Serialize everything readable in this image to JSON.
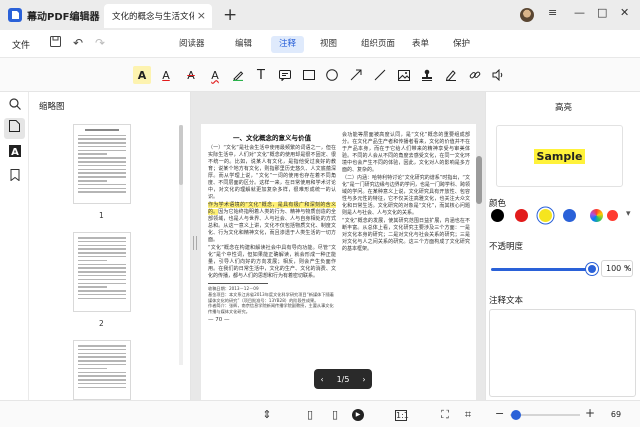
{
  "app": {
    "title": "幕动PDF编辑器"
  },
  "tabs": [
    {
      "label": "文化的概念与生活文化..."
    }
  ],
  "menu": {
    "file": "文件",
    "items": [
      {
        "label": "阅读器",
        "active": false
      },
      {
        "label": "编辑",
        "active": false
      },
      {
        "label": "注释",
        "active": true
      },
      {
        "label": "视图",
        "active": false
      },
      {
        "label": "组织页面",
        "active": false
      },
      {
        "label": "表单",
        "active": false
      },
      {
        "label": "保护",
        "active": false
      }
    ]
  },
  "toolbar": {
    "tools": [
      "highlight-icon",
      "underline-icon",
      "strikethrough-icon",
      "squiggly-icon",
      "pencil-icon",
      "text-icon",
      "note-icon",
      "rectangle-icon",
      "circle-icon",
      "arrow-icon",
      "line-icon",
      "image-icon",
      "stamp-icon",
      "signature-icon",
      "link-icon",
      "audio-icon"
    ]
  },
  "sidebar": {
    "title": "缩略图",
    "thumbnails": [
      {
        "page": "1"
      },
      {
        "page": "2"
      }
    ]
  },
  "document": {
    "left_column": {
      "heading": "一、文化概念的意义与价值",
      "para1": "（一）“文化”是社会生活中使用最频繁的词语之一，但在实际生活中，人们对“文化”概念的使用却是很不固定、很不统一的。比如，说某人有文化，是指他受过良好的教育；说某个地方有文化，则指那里历史悠久、人文底蕴深厚。而从学理上说，“文化”一词的使用也存在着不同角度、不同层面的区分。这样一来，在日常使用和学术讨论中，对文化的理解就更加复杂多样，很难形成统一的认识。",
      "para2_highlight": "作为学术语境的“文化”概念，是具有极广和深刻的含义的。",
      "para2_rest": "因为它始终指明着人类的行为、精神与物质创造的全部领域，也是人与世界、人与社会、人与自身相处的方式总和。从这一意义上讲，文化不仅包括物质文化、制度文化、行为文化和精神文化，而且渗透于人类生活的一切方面。",
      "para3": "“文化”概念在构建和解读社会中具有导向功能。尽管“文化”是个中性词，但如果能正确解读，就会形成一种正能量，引导人们向好的方向发展；相反，则会产生负面作用。在我们的日常生活中，文化的生产、文化的消费、文化的传播，都与人们的思想和行为有着密切联系。",
      "fn_received": "收稿日期：2013－12－09",
      "fn_fund": "基金项目：本文系江苏省2013年度文化科学研究项目“新媒体下随着媒体文化的研究”（项目批准号：13YB28）的阶段性成果。",
      "fn_author": "作者简介：张辉，南京信息学院新闻传播学院副教授，主要从事文化传播与媒体文化研究。",
      "page_number": "— 70 —"
    },
    "right_column": {
      "para1": "会功能等层面被高度认同，是“文化”概念的重要组成部分。在文化产品生产者和传播者看来，文化的价值并不在于产品本身，而在于它给人们带来的精神享受与审美体验。不同的人会从不同的角度去感受文化，在同一文化环境中也会产生不同的体验，因此，文化对人的影响是多方面的、复杂的。",
      "para2": "（二）内涵：哈特利特讨论“文化研究的谱系”时指出，“文化”是一门研究边缘与边界的学问，也是一门跨学科、跨领域的学问。在某种意义上说，文化研究具有开放性、包容性与多元性的特征，它不仅关注高雅文化，也关注大众文化和日常生活。文化研究的对象是“文化”，而其核心问题则是人与社会、人与文化的关系。",
      "para3": "“文化”概念的发展，使其研究范围日益扩展，内涵也在不断丰富。从总体上看，文化研究主要涉及三个方面：一是对文化本身的研究；二是对文化与社会关系的研究；三是对文化与人之间关系的研究。这三个方面构成了文化研究的基本框架。"
    },
    "pager": {
      "current": "1",
      "total": "5",
      "label": "1/5"
    }
  },
  "properties": {
    "title": "高亮",
    "preview_text": "Sample",
    "color_label": "颜色",
    "colors": [
      "#000000",
      "#e21b1b",
      "#f5e51f",
      "#2a61d8",
      "#ff3b30"
    ],
    "selected_color_index": 2,
    "opacity_label": "不透明度",
    "opacity": 100,
    "opacity_text": "100 %",
    "note_label": "注释文本"
  },
  "status": {
    "zoom": "69",
    "zoom_level": 0.05
  }
}
